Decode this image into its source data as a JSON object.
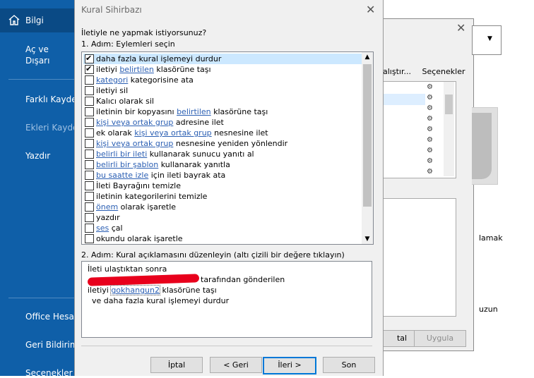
{
  "backstage": {
    "items": [
      "Bilgi",
      "Aç ve Dışarı Aktar",
      "Farklı Kaydet",
      "Ekleri Kaydet",
      "Yazdır",
      "Office Hesabı",
      "Geri Bildirim",
      "Seçenekler"
    ]
  },
  "background_dialog": {
    "actions_text": "alıştır...",
    "options_label": "Seçenekler",
    "apply_button": "Uygula",
    "cancel_partial": "tal",
    "side_text_1": "lamak",
    "side_text_2": "uzun"
  },
  "dialog": {
    "title": "Kural Sihirbazı",
    "question": "İletiyle ne yapmak istiyorsunuz?",
    "step1": "1. Adım: Eylemleri seçin",
    "step2": "2. Adım: Kural açıklamasını düzenleyin (altı çizili bir değere tıklayın)",
    "actions": [
      {
        "pre": "daha fazla kural işlemeyi durdur",
        "link": "",
        "post": "",
        "checked": true,
        "selected": true
      },
      {
        "pre": "iletiyi ",
        "link": "belirtilen",
        "post": " klasörüne taşı",
        "checked": true,
        "selected": false
      },
      {
        "pre": "",
        "link": "kategori",
        "post": " kategorisine ata",
        "checked": false,
        "selected": false
      },
      {
        "pre": "iletiyi sil",
        "link": "",
        "post": "",
        "checked": false,
        "selected": false
      },
      {
        "pre": "Kalıcı olarak sil",
        "link": "",
        "post": "",
        "checked": false,
        "selected": false
      },
      {
        "pre": "iletinin bir kopyasını ",
        "link": "belirtilen",
        "post": " klasörüne taşı",
        "checked": false,
        "selected": false
      },
      {
        "pre": "",
        "link": "kişi veya ortak grup",
        "post": " adresine ilet",
        "checked": false,
        "selected": false
      },
      {
        "pre": "ek olarak ",
        "link": "kişi veya ortak grup",
        "post": " nesnesine ilet",
        "checked": false,
        "selected": false
      },
      {
        "pre": "",
        "link": "kişi veya ortak grup",
        "post": " nesnesine yeniden yönlendir",
        "checked": false,
        "selected": false
      },
      {
        "pre": "",
        "link": "belirli bir ileti",
        "post": " kullanarak sunucu yanıtı al",
        "checked": false,
        "selected": false
      },
      {
        "pre": "",
        "link": "belirli bir şablon",
        "post": " kullanarak yanıtla",
        "checked": false,
        "selected": false
      },
      {
        "pre": "",
        "link": "bu saatte izle",
        "post": " için ileti bayrak ata",
        "checked": false,
        "selected": false
      },
      {
        "pre": "İleti Bayrağını temizle",
        "link": "",
        "post": "",
        "checked": false,
        "selected": false
      },
      {
        "pre": "iletinin kategorilerini temizle",
        "link": "",
        "post": "",
        "checked": false,
        "selected": false
      },
      {
        "pre": "",
        "link": "önem",
        "post": " olarak işaretle",
        "checked": false,
        "selected": false
      },
      {
        "pre": "yazdır",
        "link": "",
        "post": "",
        "checked": false,
        "selected": false
      },
      {
        "pre": "",
        "link": "ses",
        "post": " çal",
        "checked": false,
        "selected": false
      },
      {
        "pre": "okundu olarak işaretle",
        "link": "",
        "post": "",
        "checked": false,
        "selected": false
      }
    ],
    "description": {
      "line1": "İleti ulaştıktan sonra",
      "line2_post": "tarafından gönderilen",
      "line3_pre": "iletiyi ",
      "line3_link": "gokhangun2",
      "line3_post": " klasörüne taşı",
      "line4": "ve daha fazla kural işlemeyi durdur"
    },
    "buttons": {
      "cancel": "İptal",
      "back": "< Geri",
      "next": "İleri >",
      "finish": "Son"
    }
  }
}
